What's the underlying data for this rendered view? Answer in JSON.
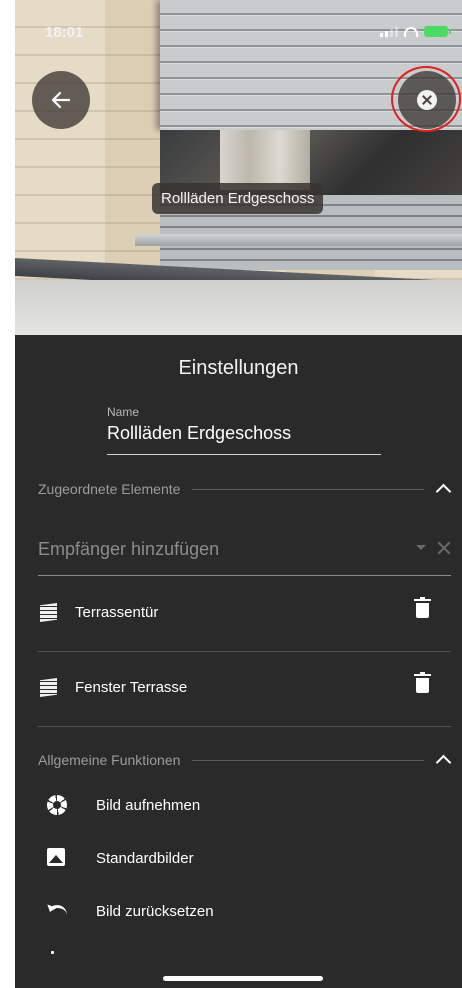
{
  "status_bar": {
    "time": "18:01"
  },
  "hero": {
    "label": "Rollläden Erdgeschoss"
  },
  "settings": {
    "title": "Einstellungen",
    "name_label": "Name",
    "name_value": "Rollläden Erdgeschoss"
  },
  "assigned": {
    "header": "Zugeordnete Elemente",
    "recipient_placeholder": "Empfänger hinzufügen",
    "items": [
      {
        "label": "Terrassentür"
      },
      {
        "label": "Fenster Terrasse"
      }
    ]
  },
  "functions": {
    "header": "Allgemeine Funktionen",
    "items": [
      {
        "label": "Bild aufnehmen",
        "icon": "camera-shutter-icon"
      },
      {
        "label": "Standardbilder",
        "icon": "image-icon"
      },
      {
        "label": "Bild zurücksetzen",
        "icon": "undo-icon"
      }
    ]
  },
  "colors": {
    "panel_bg": "#2a2a2a",
    "highlight_ring": "#e02020",
    "battery": "#4cd964"
  }
}
